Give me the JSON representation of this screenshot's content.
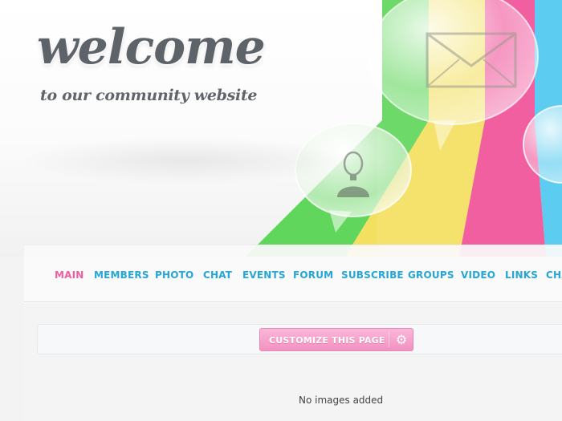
{
  "header": {
    "title": "welcome",
    "subtitle": "to our community website"
  },
  "nav": {
    "items": [
      {
        "label": "MAIN",
        "active": true
      },
      {
        "label": "MEMBERS",
        "active": false
      },
      {
        "label": "PHOTO",
        "active": false
      },
      {
        "label": "CHAT",
        "active": false
      },
      {
        "label": "EVENTS",
        "active": false
      },
      {
        "label": "FORUM",
        "active": false
      },
      {
        "label": "SUBSCRIBE",
        "active": false
      },
      {
        "label": "GROUPS",
        "active": false
      },
      {
        "label": "VIDEO",
        "active": false
      },
      {
        "label": "LINKS",
        "active": false
      },
      {
        "label": "CHA",
        "active": false
      }
    ],
    "active_color": "#ef5f9e",
    "link_color": "#25a6d6"
  },
  "toolbar": {
    "customize_label": "CUSTOMIZE THIS PAGE",
    "settings_icon": "gear-icon"
  },
  "main": {
    "empty_message": "No images added"
  },
  "decor": {
    "stripe_colors": [
      "#61d65c",
      "#f3e060",
      "#f0529a",
      "#4fc8ef"
    ],
    "icons": [
      "envelope-icon",
      "user-icon"
    ]
  }
}
